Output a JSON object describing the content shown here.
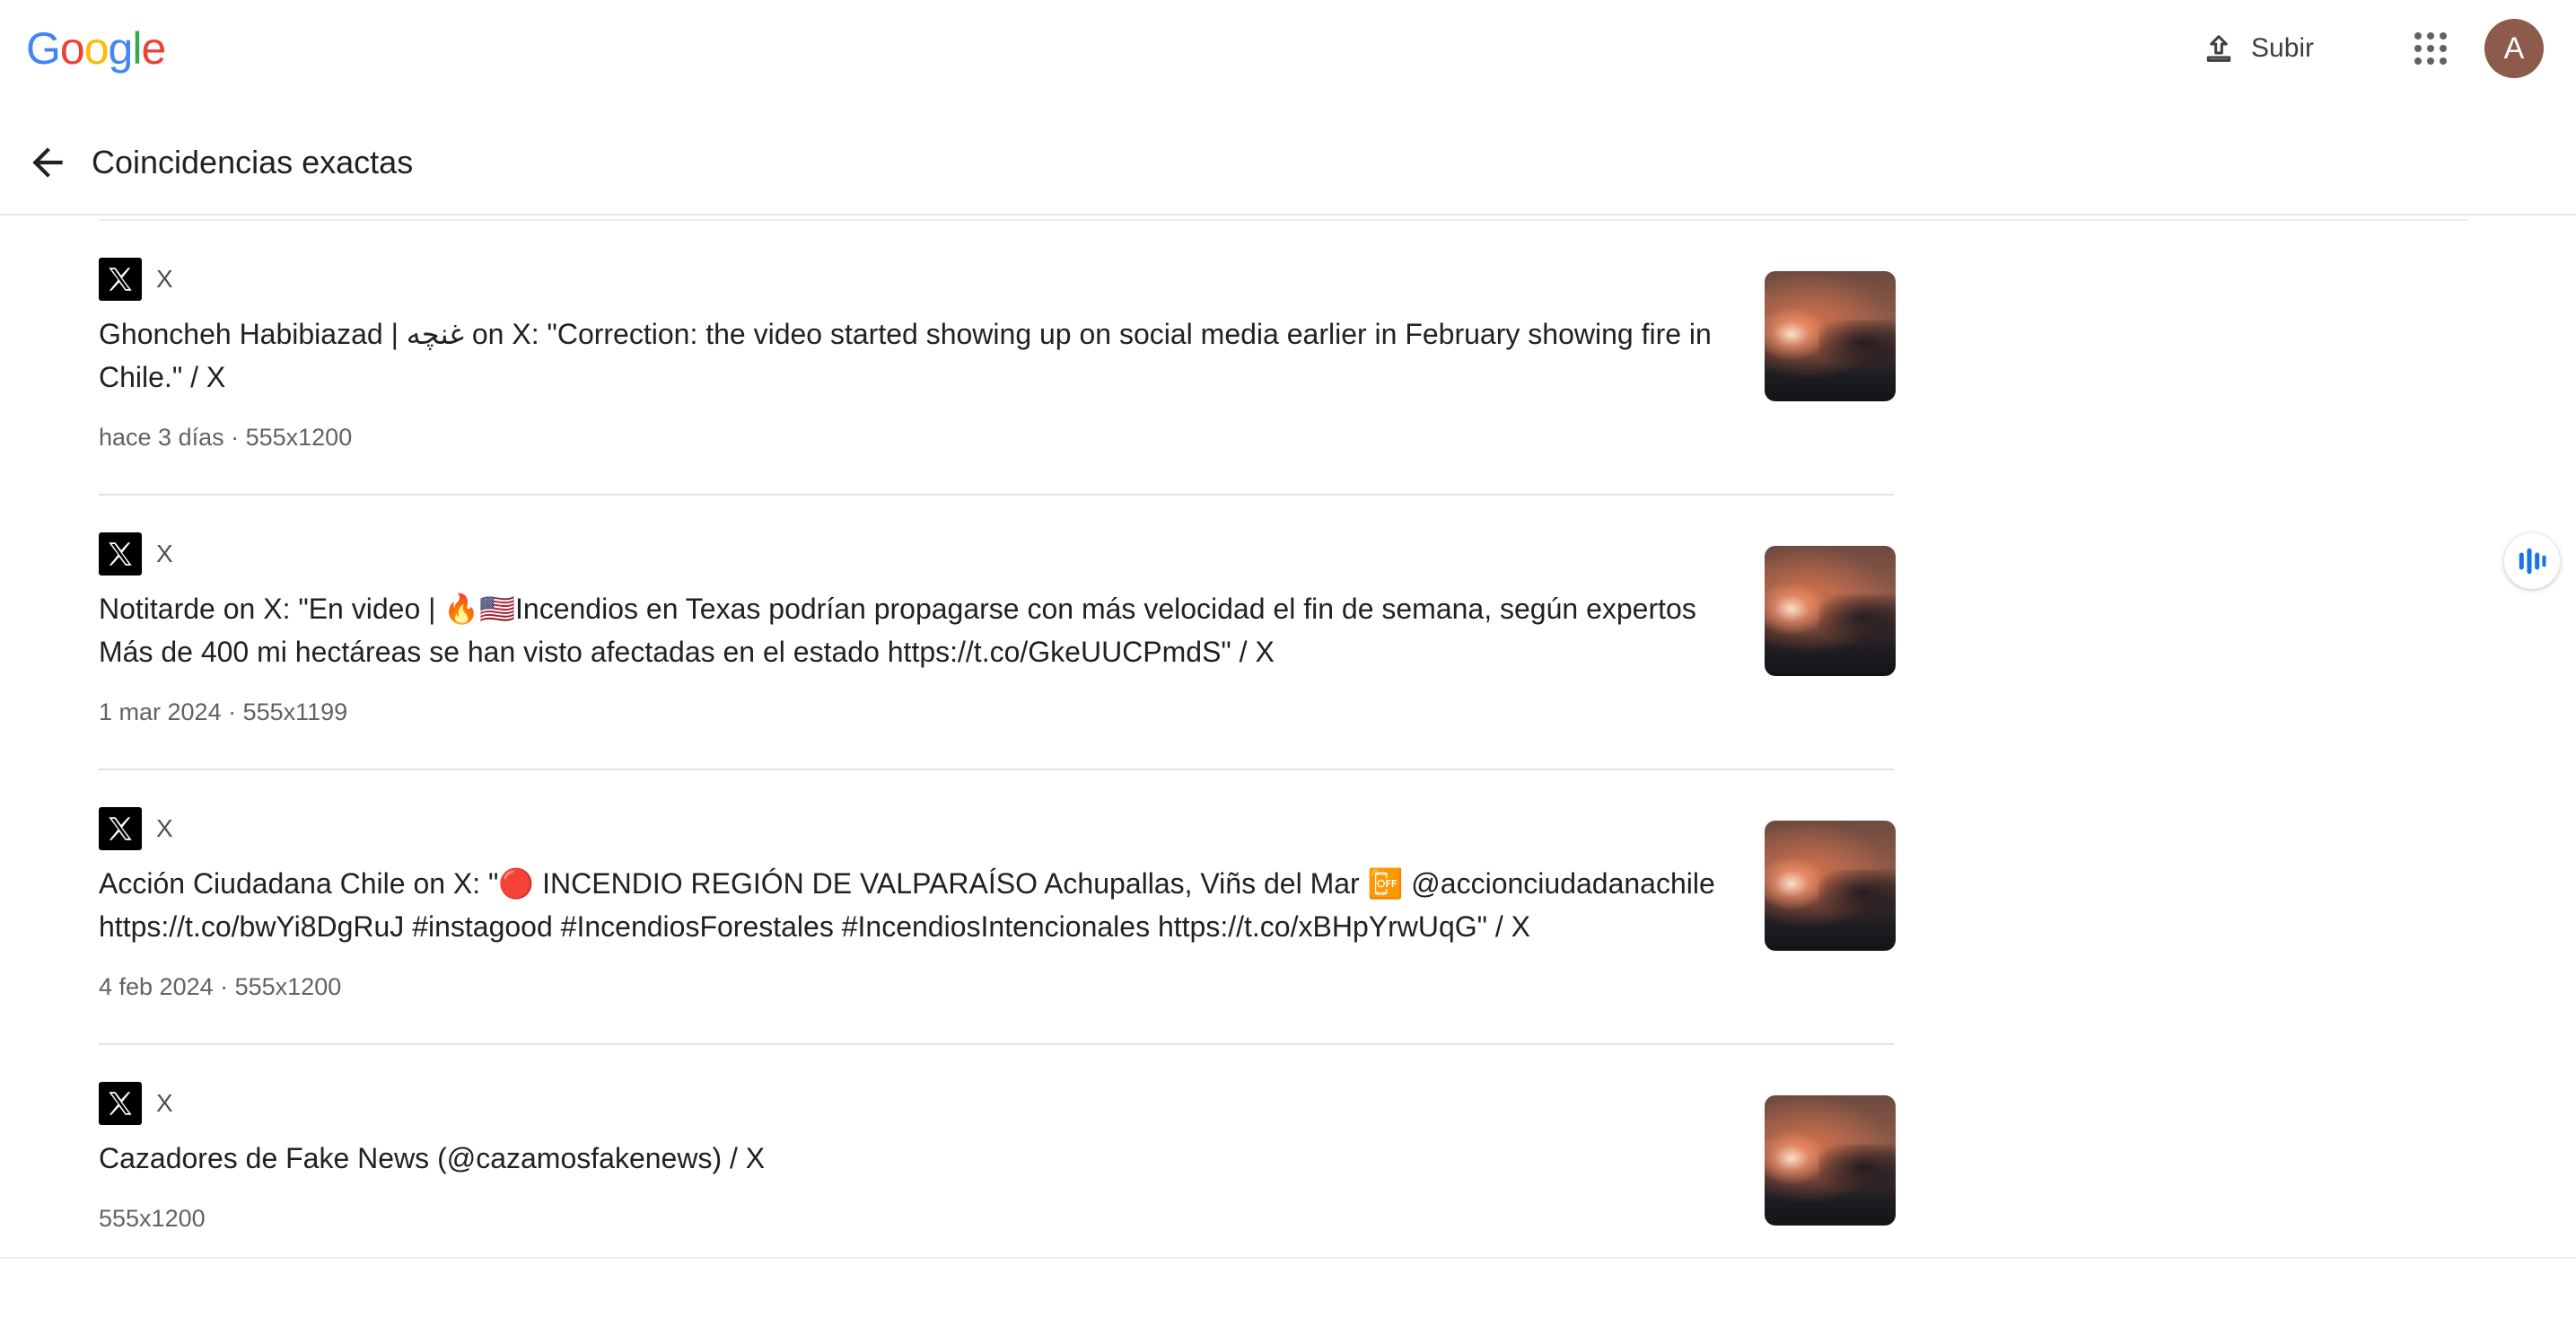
{
  "brand": {
    "logo_letters": [
      "G",
      "o",
      "o",
      "g",
      "l",
      "e"
    ],
    "logo_colors": [
      "#4285F4",
      "#EA4335",
      "#FBBC05",
      "#4285F4",
      "#34A853",
      "#EA4335"
    ]
  },
  "topbar": {
    "upload_label": "Subir",
    "upload_icon": "upload-icon",
    "apps_icon": "apps-grid-icon",
    "avatar_letter": "A",
    "avatar_color": "#8d5b4c"
  },
  "header": {
    "back_icon": "arrow-left-icon",
    "title": "Coincidencias exactas"
  },
  "results": [
    {
      "source": "X",
      "title": "Ghoncheh Habibiazad | غنچه on X: \"Correction: the video started showing up on social media earlier in February showing fire in Chile.\" / X",
      "meta": "hace 3 días · 555x1200"
    },
    {
      "source": "X",
      "title": "Notitarde on X: \"En video | 🔥🇺🇸Incendios en Texas podrían propagarse con más velocidad el fin de semana, según expertos Más de 400 mi hectáreas se han visto afectadas en el estado https://t.co/GkeUUCPmdS\" / X",
      "meta": "1 mar 2024 · 555x1199"
    },
    {
      "source": "X",
      "title": "Acción Ciudadana Chile on X: \"🔴 INCENDIO REGIÓN DE VALPARAÍSO Achupallas, Viñs del Mar 📴 @accionciudadanachile https://t.co/bwYi8DgRuJ #instagood #IncendiosForestales #IncendiosIntencionales https://t.co/xBHpYrwUqG\" / X",
      "meta": "4 feb 2024 · 555x1200"
    },
    {
      "source": "X",
      "title": "Cazadores de Fake News (@cazamosfakenews) / X",
      "meta": "555x1200"
    }
  ],
  "side_button_icon": "audio-bars-icon"
}
